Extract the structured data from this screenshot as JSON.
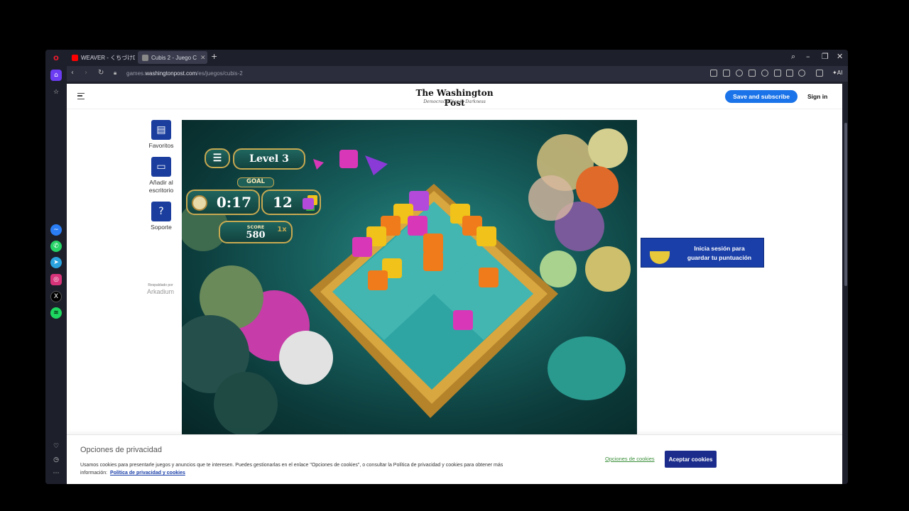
{
  "browser": {
    "tabs": [
      {
        "label": "WEAVER - くちづけDiam",
        "active": false
      },
      {
        "label": "Cubis 2 - Juego C",
        "active": true
      }
    ],
    "url_prefix": "games.",
    "url_domain": "washingtonpost.com",
    "url_path": "/es/juegos/cubis-2",
    "ai_label": "AI"
  },
  "header": {
    "logo": "The Washington Post",
    "tagline": "Democracy Dies in Darkness",
    "subscribe_label": "Save and subscribe",
    "signin_label": "Sign in"
  },
  "side_tools": [
    {
      "label": "Favoritos",
      "icon": "document-icon"
    },
    {
      "label": "Añadir al escritorio",
      "icon": "monitor-icon"
    },
    {
      "label": "Soporte",
      "icon": "help-icon"
    }
  ],
  "powered_by": "Respaldado por",
  "arkadium": "Arkadium",
  "game": {
    "level": "Level 3",
    "goal_label": "GOAL",
    "time": "0:17",
    "goal_count": "12",
    "score_label": "SCORE",
    "score": "580",
    "multiplier": "1x"
  },
  "signin_banner": {
    "line1": "Inicia sesión para",
    "line2": "guardar tu puntuación"
  },
  "cookie": {
    "title": "Opciones de privacidad",
    "text": "Usamos cookies para presentarle juegos y anuncios que te interesen. Puedes gestionarlas en el enlace \"Opciones de cookies\", o consultar la Política de privacidad y cookies para obtener más información:",
    "link": "Política de privacidad y cookies",
    "options_label": "Opciones de cookies",
    "accept_label": "Aceptar cookies"
  },
  "colors": {
    "accent_blue": "#1a73e8",
    "banner_blue": "#1a3fa8",
    "accept_navy": "#1b2c8c",
    "browser_dark": "#1d1f2b"
  }
}
